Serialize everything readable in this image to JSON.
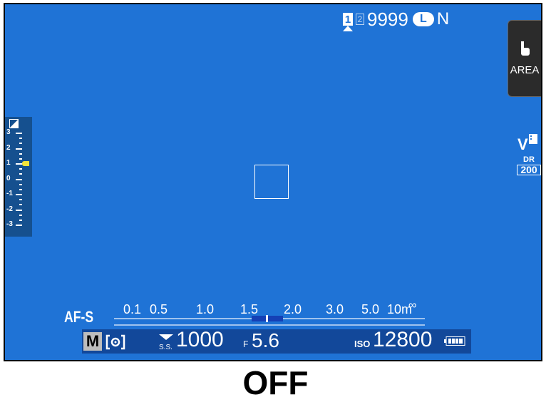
{
  "top": {
    "card_slot_1": "1",
    "card_slot_2": "2",
    "shots_remaining": "9999",
    "image_size": "L",
    "image_quality": "N"
  },
  "touch_button": {
    "label": "AREA",
    "icon": "touch-finger-icon"
  },
  "right_icons": {
    "film_simulation": "V",
    "dr_label": "DR",
    "dr_value": "200"
  },
  "exposure_comp": {
    "icon": "exposure-compensation-icon",
    "labels": [
      "3",
      "2",
      "1",
      "0",
      "-1",
      "-2",
      "-3"
    ],
    "current": 1
  },
  "focus_mode": "AF-S",
  "distance_scale": {
    "labels": [
      "0.1",
      "0.5",
      "1.0",
      "1.5",
      "2.0",
      "3.0",
      "5.0",
      "10m",
      "∞"
    ]
  },
  "bottom": {
    "exposure_mode": "M",
    "metering_icon": "metering-multi-icon",
    "shutter_prefix": "S.S.",
    "shutter_speed": "1000",
    "aperture_prefix": "F",
    "aperture": "5.6",
    "iso_prefix": "ISO",
    "iso": "12800",
    "battery_icon": "battery-full-icon"
  },
  "caption": "OFF",
  "colors": {
    "screen_bg": "#1f73d6",
    "exposure_indicator": "#f3e33a"
  }
}
